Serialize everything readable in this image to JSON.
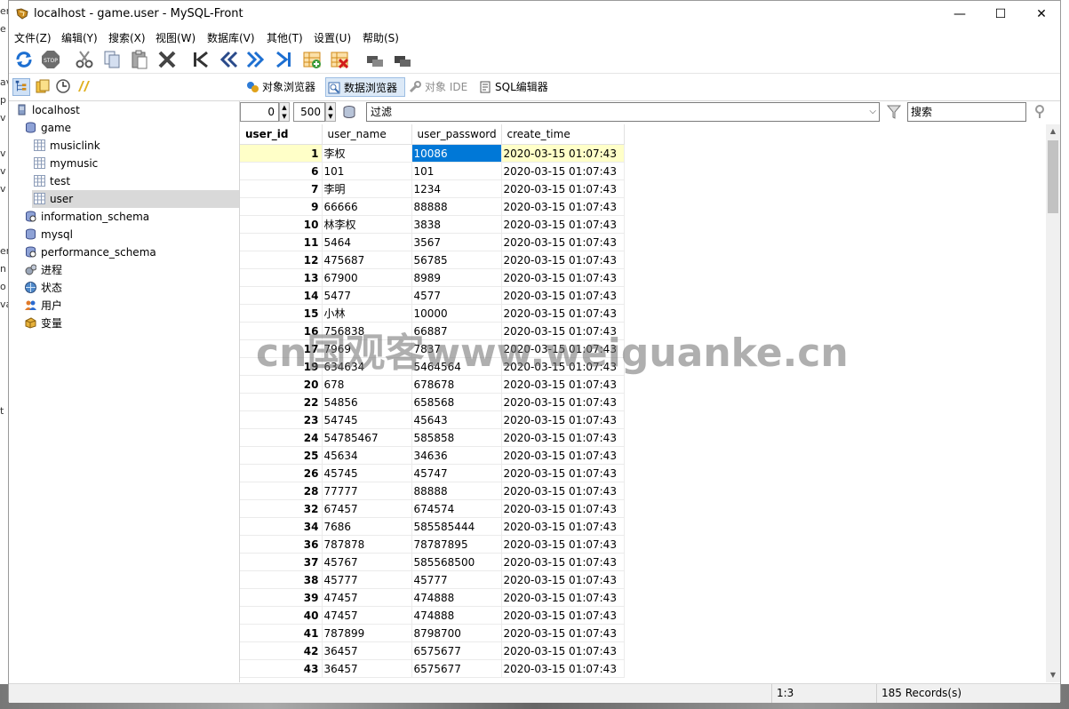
{
  "window": {
    "title": "localhost - game.user - MySQL-Front",
    "minimize_glyph": "—",
    "maximize_glyph": "☐",
    "close_glyph": "✕"
  },
  "menu": [
    "文件(Z)",
    "编辑(Y)",
    "搜索(X)",
    "视图(W)",
    "数据库(V)",
    "其他(T)",
    "设置(U)",
    "帮助(S)"
  ],
  "toolbar_icons": [
    "refresh-icon",
    "stop-icon",
    "cut-icon",
    "copy-icon",
    "paste-icon",
    "delete-icon",
    "first-record-icon",
    "prev-page-icon",
    "next-page-icon",
    "last-record-icon",
    "insert-record-icon",
    "delete-record-icon",
    "post-icon",
    "cancel-icon"
  ],
  "view_tabs": [
    {
      "label": "对象浏览器",
      "icon": "object-browser-icon"
    },
    {
      "label": "数据浏览器",
      "icon": "data-browser-icon"
    },
    {
      "label": "对象 IDE",
      "icon": "object-ide-icon"
    },
    {
      "label": "SQL编辑器",
      "icon": "sql-editor-icon"
    }
  ],
  "sidebar_icons": [
    "tree-view-icon",
    "bookmarks-icon",
    "history-icon",
    "jobs-icon"
  ],
  "tree": [
    {
      "label": "localhost",
      "icon": "server-icon",
      "level": 0
    },
    {
      "label": "game",
      "icon": "database-icon",
      "level": 1
    },
    {
      "label": "musiclink",
      "icon": "table-icon",
      "level": 2
    },
    {
      "label": "mymusic",
      "icon": "table-icon",
      "level": 2
    },
    {
      "label": "test",
      "icon": "table-icon",
      "level": 2
    },
    {
      "label": "user",
      "icon": "table-icon",
      "level": 2,
      "selected": true
    },
    {
      "label": "information_schema",
      "icon": "system-database-icon",
      "level": 1
    },
    {
      "label": "mysql",
      "icon": "database-icon",
      "level": 1
    },
    {
      "label": "performance_schema",
      "icon": "system-database-icon",
      "level": 1
    },
    {
      "label": "进程",
      "icon": "processes-icon",
      "level": 1
    },
    {
      "label": "状态",
      "icon": "status-icon",
      "level": 1
    },
    {
      "label": "用户",
      "icon": "users-icon",
      "level": 1
    },
    {
      "label": "变量",
      "icon": "variables-icon",
      "level": 1
    }
  ],
  "filter": {
    "offset": "0",
    "limit": "500",
    "filter_placeholder": "过滤",
    "search_placeholder": "搜索"
  },
  "grid": {
    "columns": [
      "user_id",
      "user_name",
      "user_password",
      "create_time"
    ],
    "rows": [
      [
        "1",
        "李权",
        "10086",
        "2020-03-15 01:07:43"
      ],
      [
        "6",
        "101",
        "101",
        "2020-03-15 01:07:43"
      ],
      [
        "7",
        "李明",
        "1234",
        "2020-03-15 01:07:43"
      ],
      [
        "9",
        "66666",
        "88888",
        "2020-03-15 01:07:43"
      ],
      [
        "10",
        "林李权",
        "3838",
        "2020-03-15 01:07:43"
      ],
      [
        "11",
        "5464",
        "3567",
        "2020-03-15 01:07:43"
      ],
      [
        "12",
        "475687",
        "56785",
        "2020-03-15 01:07:43"
      ],
      [
        "13",
        "67900",
        "8989",
        "2020-03-15 01:07:43"
      ],
      [
        "14",
        "5477",
        "4577",
        "2020-03-15 01:07:43"
      ],
      [
        "15",
        "小林",
        "10000",
        "2020-03-15 01:07:43"
      ],
      [
        "16",
        "756838",
        "66887",
        "2020-03-15 01:07:43"
      ],
      [
        "17",
        "7969",
        "7837",
        "2020-03-15 01:07:43"
      ],
      [
        "19",
        "634634",
        "5464564",
        "2020-03-15 01:07:43"
      ],
      [
        "20",
        "678",
        "678678",
        "2020-03-15 01:07:43"
      ],
      [
        "22",
        "54856",
        "658568",
        "2020-03-15 01:07:43"
      ],
      [
        "23",
        "54745",
        "45643",
        "2020-03-15 01:07:43"
      ],
      [
        "24",
        "54785467",
        "585858",
        "2020-03-15 01:07:43"
      ],
      [
        "25",
        "45634",
        "34636",
        "2020-03-15 01:07:43"
      ],
      [
        "26",
        "45745",
        "45747",
        "2020-03-15 01:07:43"
      ],
      [
        "28",
        "77777",
        "88888",
        "2020-03-15 01:07:43"
      ],
      [
        "32",
        "67457",
        "674574",
        "2020-03-15 01:07:43"
      ],
      [
        "34",
        "7686",
        "585585444",
        "2020-03-15 01:07:43"
      ],
      [
        "36",
        "787878",
        "78787895",
        "2020-03-15 01:07:43"
      ],
      [
        "37",
        "45767",
        "585568500",
        "2020-03-15 01:07:43"
      ],
      [
        "38",
        "45777",
        "45777",
        "2020-03-15 01:07:43"
      ],
      [
        "39",
        "47457",
        "474888",
        "2020-03-15 01:07:43"
      ],
      [
        "40",
        "47457",
        "474888",
        "2020-03-15 01:07:43"
      ],
      [
        "41",
        "787899",
        "8798700",
        "2020-03-15 01:07:43"
      ],
      [
        "42",
        "36457",
        "6575677",
        "2020-03-15 01:07:43"
      ],
      [
        "43",
        "36457",
        "6575677",
        "2020-03-15 01:07:43"
      ]
    ]
  },
  "status": {
    "position": "1:3",
    "records": "185 Records(s)"
  },
  "watermark": "cn国观客www.weiguanke.cn",
  "colors": {
    "selection": "#0078d7",
    "row_highlight": "#ffffc8",
    "tab_active": "#dce9f7"
  }
}
